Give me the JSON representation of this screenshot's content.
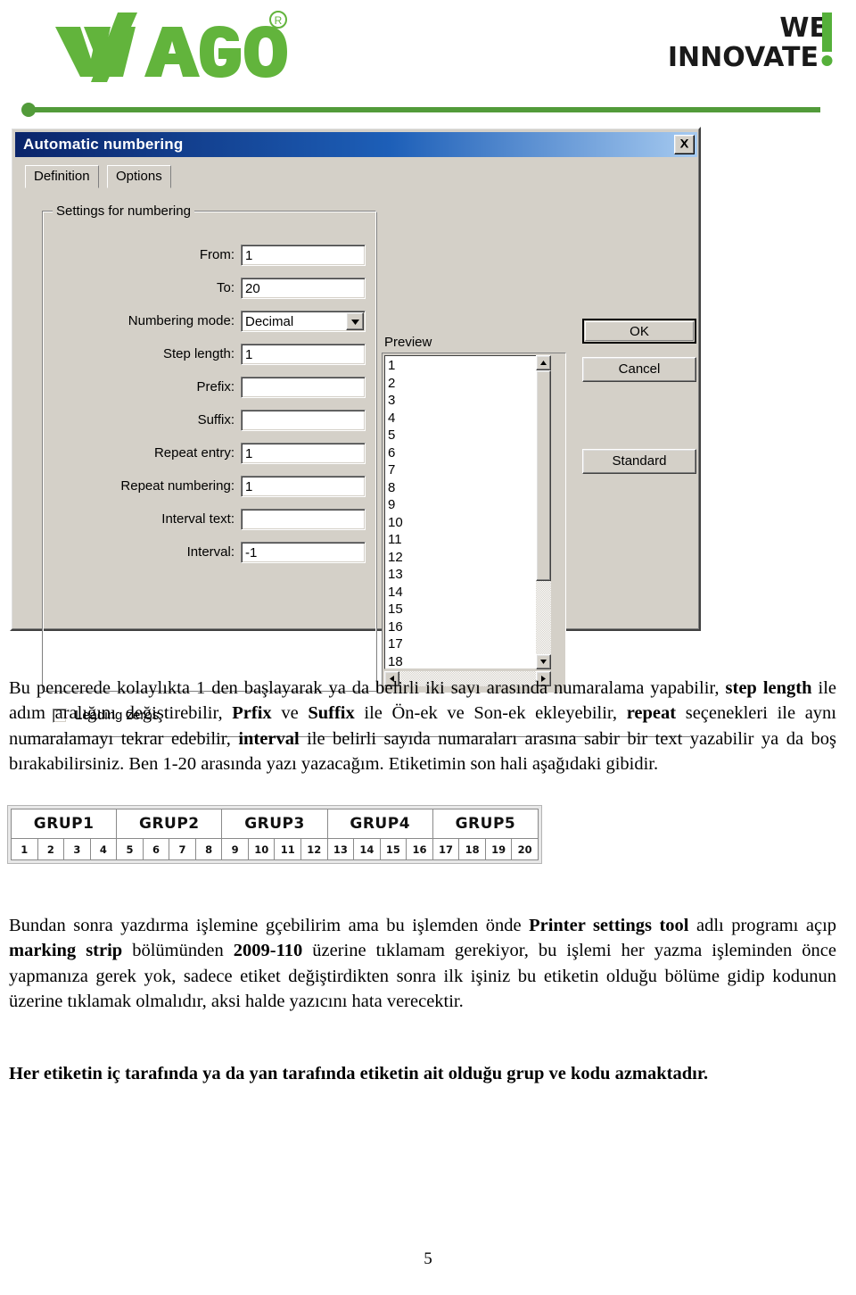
{
  "header": {
    "brand": "WAGO",
    "registered_mark": "®",
    "tagline_line1": "WE",
    "tagline_line2": "INNOVATE",
    "tagline_mark": "!",
    "brand_color": "#62b43c",
    "tagline_color": "#1a1a1a"
  },
  "dialog": {
    "title": "Automatic numbering",
    "close_label": "x",
    "tabs": [
      {
        "label": "Definition",
        "active": true
      },
      {
        "label": "Options",
        "active": false
      }
    ],
    "groupbox_title": "Settings for numbering",
    "fields": [
      {
        "label": "From:",
        "value": "1",
        "type": "text"
      },
      {
        "label": "To:",
        "value": "20",
        "type": "text"
      },
      {
        "label": "Numbering mode:",
        "value": "Decimal",
        "type": "select"
      },
      {
        "label": "Step length:",
        "value": "1",
        "type": "text"
      },
      {
        "label": "Prefix:",
        "value": "",
        "type": "text"
      },
      {
        "label": "Suffix:",
        "value": "",
        "type": "text"
      },
      {
        "label": "Repeat entry:",
        "value": "1",
        "type": "text"
      },
      {
        "label": "Repeat numbering:",
        "value": "1",
        "type": "text"
      },
      {
        "label": "Interval text:",
        "value": "",
        "type": "text"
      },
      {
        "label": "Interval:",
        "value": "-1",
        "type": "text"
      }
    ],
    "checkbox": {
      "label": "Leading zeros",
      "checked": false
    },
    "preview": {
      "label": "Preview",
      "items": [
        "1",
        "2",
        "3",
        "4",
        "5",
        "6",
        "7",
        "8",
        "9",
        "10",
        "11",
        "12",
        "13",
        "14",
        "15",
        "16",
        "17",
        "18"
      ]
    },
    "buttons": {
      "ok": "OK",
      "cancel": "Cancel",
      "standard": "Standard"
    }
  },
  "label_strip": {
    "groups": [
      "GRUP1",
      "GRUP2",
      "GRUP3",
      "GRUP4",
      "GRUP5"
    ],
    "numbers": [
      "1",
      "2",
      "3",
      "4",
      "5",
      "6",
      "7",
      "8",
      "9",
      "10",
      "11",
      "12",
      "13",
      "14",
      "15",
      "16",
      "17",
      "18",
      "19",
      "20"
    ]
  },
  "body": {
    "paragraph1_html": "Bu pencerede kolaylıkta 1 den başlayarak ya da belirli iki sayı arasında numaralama yapabilir, <b class=\"b\">step length</b> ile adım aralığını değiştirebilir, <b class=\"b\">Prfix</b> ve <b class=\"b\">Suffix</b> ile Ön-ek ve Son-ek ekleyebilir, <b class=\"b\">repeat</b> seçenekleri ile aynı numaralamayı tekrar edebilir, <b class=\"b\">interval</b> ile belirli sayıda numaraları arasına sabir bir text yazabilir ya da boş bırakabilirsiniz. Ben 1-20 arasında yazı yazacağım. Etiketimin son hali aşağıdaki gibidir.",
    "paragraph2_html": "Bundan sonra yazdırma işlemine gçebilirim ama bu işlemden önde <b class=\"b\">Printer settings tool</b> adlı programı açıp <b class=\"b\">marking strip</b> bölümünden <b class=\"b\">2009-110</b> üzerine tıklamam gerekiyor, bu işlemi her yazma işleminden önce yapmanıza gerek yok, sadece etiket değiştirdikten sonra ilk işiniz bu etiketin olduğu bölüme gidip kodunun üzerine tıklamak olmalıdır, aksi halde yazıcını hata verecektir.",
    "paragraph3_html": "Her etiketin iç tarafında ya da yan tarafında etiketin ait olduğu grup ve kodu azmaktadır."
  },
  "page_number": "5"
}
